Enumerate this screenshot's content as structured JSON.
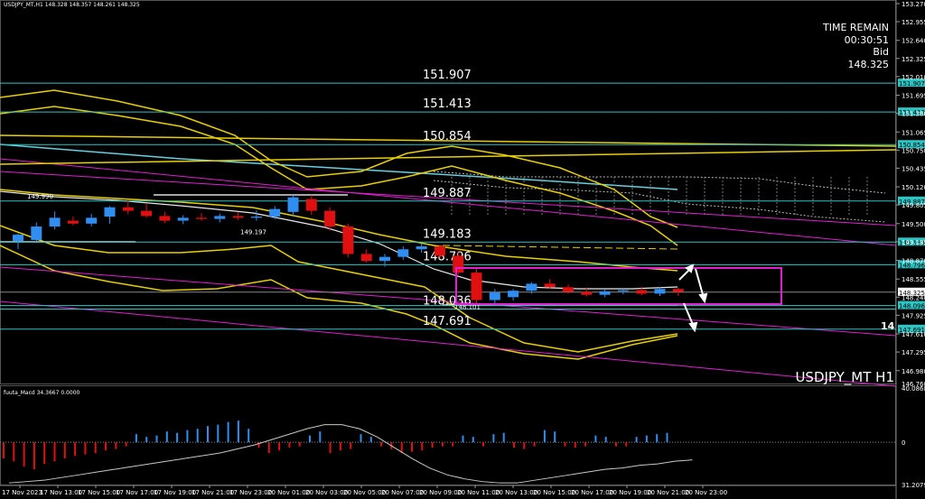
{
  "header": {
    "symbol_text": "USDJPY_MT,H1 148.328 148.357 148.261 148.325"
  },
  "info_panel": {
    "time_remain_label": "TIME REMAIN",
    "time_remain_value": "00:30:51",
    "bid_label": "Bid",
    "bid_value": "148.325"
  },
  "watermark": "USDJPY_MT H1",
  "right_edge_mark": "14",
  "chart_data": [
    {
      "type": "line",
      "name": "main-price-chart",
      "x_labels": [
        "17 Nov 2023",
        "17 Nov 13:00",
        "17 Nov 15:00",
        "17 Nov 17:00",
        "17 Nov 19:00",
        "17 Nov 21:00",
        "17 Nov 23:00",
        "20 Nov 01:00",
        "20 Nov 03:00",
        "20 Nov 05:00",
        "20 Nov 07:00",
        "20 Nov 09:00",
        "20 Nov 11:00",
        "20 Nov 13:00",
        "20 Nov 15:00",
        "20 Nov 17:00",
        "20 Nov 19:00",
        "20 Nov 21:00",
        "20 Nov 23:00"
      ],
      "y_ticks": [
        153.27,
        152.96,
        152.64,
        152.33,
        152.02,
        151.7,
        151.39,
        151.07,
        150.76,
        150.45,
        150.13,
        149.82,
        149.5,
        149.19,
        148.87,
        148.55,
        148.24,
        147.93,
        147.61,
        147.3,
        146.98
      ],
      "y_tick_labels": [
        "153.270",
        "152.955",
        "152.640",
        "152.325",
        "152.010",
        "151.695",
        "151.380",
        "151.065",
        "150.750",
        "150.435",
        "150.120",
        "149.805",
        "149.500",
        "149.185",
        "148.870",
        "148.555",
        "148.240",
        "147.925",
        "147.610",
        "147.295",
        "146.980"
      ],
      "right_axis_text": {
        "bottom_label": "146.760",
        "ticks": [
          "153.270",
          "152.955",
          "152.640",
          "152.325",
          "152.010",
          "151.695",
          "151.380",
          "151.065",
          "150.750",
          "150.435",
          "150.120",
          "149.805",
          "149.500",
          "149.185",
          "148.870",
          "148.555",
          "148.240",
          "147.925",
          "147.610",
          "147.295",
          "146.980"
        ]
      },
      "ylim": [
        146.76,
        153.27
      ],
      "candles": [
        {
          "o": 149.2,
          "h": 149.33,
          "l": 149.06,
          "c": 149.31
        },
        {
          "o": 149.22,
          "h": 149.52,
          "l": 149.2,
          "c": 149.45
        },
        {
          "o": 149.45,
          "h": 149.71,
          "l": 149.4,
          "c": 149.6
        },
        {
          "o": 149.55,
          "h": 149.62,
          "l": 149.47,
          "c": 149.5
        },
        {
          "o": 149.5,
          "h": 149.67,
          "l": 149.45,
          "c": 149.6
        },
        {
          "o": 149.62,
          "h": 149.8,
          "l": 149.5,
          "c": 149.78
        },
        {
          "o": 149.78,
          "h": 149.9,
          "l": 149.66,
          "c": 149.72
        },
        {
          "o": 149.72,
          "h": 149.85,
          "l": 149.6,
          "c": 149.63
        },
        {
          "o": 149.63,
          "h": 149.7,
          "l": 149.51,
          "c": 149.55
        },
        {
          "o": 149.55,
          "h": 149.64,
          "l": 149.49,
          "c": 149.6
        },
        {
          "o": 149.6,
          "h": 149.68,
          "l": 149.55,
          "c": 149.58
        },
        {
          "o": 149.58,
          "h": 149.67,
          "l": 149.52,
          "c": 149.63
        },
        {
          "o": 149.63,
          "h": 149.7,
          "l": 149.56,
          "c": 149.6
        },
        {
          "o": 149.6,
          "h": 149.73,
          "l": 149.55,
          "c": 149.62
        },
        {
          "o": 149.62,
          "h": 149.8,
          "l": 149.57,
          "c": 149.75
        },
        {
          "o": 149.7,
          "h": 149.99,
          "l": 149.62,
          "c": 149.95
        },
        {
          "o": 149.92,
          "h": 149.99,
          "l": 149.65,
          "c": 149.72
        },
        {
          "o": 149.72,
          "h": 149.78,
          "l": 149.38,
          "c": 149.45
        },
        {
          "o": 149.45,
          "h": 149.5,
          "l": 148.92,
          "c": 148.98
        },
        {
          "o": 148.98,
          "h": 149.06,
          "l": 148.83,
          "c": 148.86
        },
        {
          "o": 148.86,
          "h": 148.98,
          "l": 148.76,
          "c": 148.93
        },
        {
          "o": 148.93,
          "h": 149.11,
          "l": 148.88,
          "c": 149.06
        },
        {
          "o": 149.06,
          "h": 149.16,
          "l": 149.0,
          "c": 149.11
        },
        {
          "o": 149.11,
          "h": 149.14,
          "l": 148.9,
          "c": 148.95
        },
        {
          "o": 148.95,
          "h": 149.04,
          "l": 148.62,
          "c": 148.66
        },
        {
          "o": 148.66,
          "h": 148.75,
          "l": 148.1,
          "c": 148.19
        },
        {
          "o": 148.19,
          "h": 148.38,
          "l": 148.1,
          "c": 148.32
        },
        {
          "o": 148.24,
          "h": 148.38,
          "l": 148.18,
          "c": 148.35
        },
        {
          "o": 148.35,
          "h": 148.5,
          "l": 148.3,
          "c": 148.47
        },
        {
          "o": 148.47,
          "h": 148.55,
          "l": 148.38,
          "c": 148.41
        },
        {
          "o": 148.41,
          "h": 148.46,
          "l": 148.3,
          "c": 148.33
        },
        {
          "o": 148.33,
          "h": 148.4,
          "l": 148.25,
          "c": 148.28
        },
        {
          "o": 148.28,
          "h": 148.38,
          "l": 148.24,
          "c": 148.34
        },
        {
          "o": 148.34,
          "h": 148.4,
          "l": 148.29,
          "c": 148.36
        },
        {
          "o": 148.36,
          "h": 148.42,
          "l": 148.27,
          "c": 148.3
        },
        {
          "o": 148.3,
          "h": 148.41,
          "l": 148.26,
          "c": 148.38
        },
        {
          "o": 148.38,
          "h": 148.4,
          "l": 148.26,
          "c": 148.33
        }
      ],
      "levels": [
        {
          "value": 151.907,
          "label": "151.907",
          "axis_label": "151.907"
        },
        {
          "value": 151.413,
          "label": "151.413",
          "axis_label": "151.413"
        },
        {
          "value": 150.854,
          "label": "150.854",
          "axis_label": "150.854"
        },
        {
          "value": 149.887,
          "label": "149.887",
          "axis_label": "149.887"
        },
        {
          "value": 149.183,
          "label": "149.183",
          "axis_label": "149.183"
        },
        {
          "value": 148.796,
          "label": "148.796",
          "axis_label": "148.796"
        },
        {
          "value": 148.325,
          "label": "",
          "axis_label": "148.325"
        },
        {
          "value": 148.096,
          "label": "",
          "axis_label": "148.096"
        },
        {
          "value": 148.036,
          "label": "148.036",
          "axis_label": ""
        },
        {
          "value": 147.691,
          "label": "147.691",
          "axis_label": "147.691"
        }
      ],
      "price_annotations": [
        {
          "text": "149.990",
          "value": 149.99
        },
        {
          "text": "149.197",
          "value": 149.197
        },
        {
          "text": "148.101",
          "value": 148.101
        }
      ],
      "colors": {
        "bull": "#2f8ef0",
        "bear": "#e01010",
        "level": "#2ec4c4",
        "bands": "#e8d000",
        "trend": "#e020d0",
        "ichimoku": "#6ad0e0",
        "box": "#e020d0",
        "arrow": "#ffffff"
      }
    },
    {
      "type": "bar",
      "name": "fuuta_Macd",
      "title": "fuuta_Macd 34.3667 0.0000",
      "y_tick_labels": [
        "40.0868",
        "0",
        "31.2079"
      ],
      "ylim": [
        -31.2079,
        40.0868
      ],
      "values": [
        -12,
        -14,
        -18,
        -20,
        -16,
        -14,
        -12,
        -10,
        -9,
        -8,
        -6,
        -5,
        -3,
        6,
        4,
        5,
        8,
        7,
        9,
        10,
        12,
        13,
        15,
        16,
        10,
        -4,
        -8,
        -6,
        -4,
        -3,
        5,
        8,
        -8,
        -6,
        -5,
        6,
        4,
        -3,
        -5,
        -8,
        -7,
        -6,
        -4,
        -3,
        -3,
        5,
        4,
        -3,
        6,
        7,
        -4,
        -5,
        -3,
        9,
        8,
        -3,
        -4,
        -3,
        5,
        4,
        -3,
        -3,
        4,
        5,
        6,
        7
      ],
      "signal": [
        -30,
        -29,
        -28,
        -26,
        -24,
        -22,
        -20,
        -18,
        -16,
        -14,
        -12,
        -10,
        -8,
        -5,
        -2,
        2,
        6,
        10,
        13,
        13,
        10,
        4,
        -4,
        -12,
        -19,
        -24,
        -27,
        -29,
        -30,
        -30,
        -28,
        -26,
        -24,
        -22,
        -20,
        -19,
        -17,
        -16,
        -14,
        -13
      ],
      "signal_color": "#c8c8c8"
    }
  ]
}
